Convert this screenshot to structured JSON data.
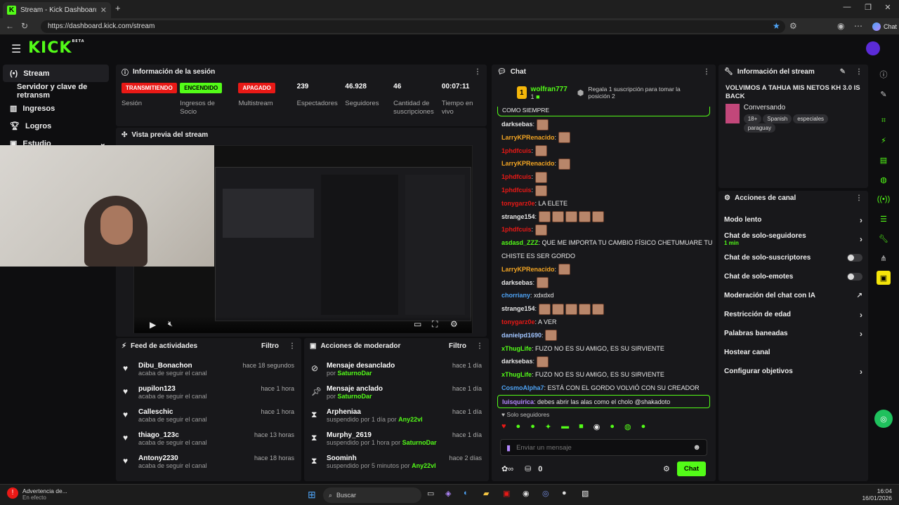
{
  "browser": {
    "tab_title": "Stream - Kick Dashboard",
    "url": "https://dashboard.kick.com/stream",
    "chat_label": "Chat"
  },
  "logo": "KICK",
  "logo_sub": "BETA",
  "sidebar": {
    "items": [
      {
        "label": "Stream",
        "icon": "stream-icon"
      },
      {
        "label": "Servidor y clave de retransm"
      },
      {
        "label": "Ingresos",
        "icon": "chart-icon"
      },
      {
        "label": "Logros",
        "icon": "trophy-icon"
      },
      {
        "label": "Estudio",
        "icon": "studio-icon"
      }
    ]
  },
  "session": {
    "title": "Información de la sesión",
    "badges": [
      {
        "value": "TRANSMITIENDO",
        "label": "Sesión",
        "color": "#e91916",
        "text": "#ffffff"
      },
      {
        "value": "ENCENDIDO",
        "label": "Ingresos de Socio",
        "color": "#53fc18",
        "text": "#000000"
      },
      {
        "value": "APAGADO",
        "label": "Multistream",
        "color": "#e91916",
        "text": "#ffffff"
      }
    ],
    "stats": [
      {
        "value": "239",
        "label": "Espectadores"
      },
      {
        "value": "46.928",
        "label": "Seguidores"
      },
      {
        "value": "46",
        "label": "Cantidad de suscripciones"
      },
      {
        "value": "00:07:11",
        "label": "Tiempo en vivo"
      }
    ]
  },
  "preview": {
    "title": "Vista previa del stream"
  },
  "feed": {
    "title": "Feed de actividades",
    "filter": "Filtro",
    "items": [
      {
        "name": "Dibu_Bonachon",
        "sub": "acaba de seguir el canal",
        "time": "hace 18 segundos"
      },
      {
        "name": "pupilon123",
        "sub": "acaba de seguir el canal",
        "time": "hace 1 hora"
      },
      {
        "name": "Calleschic",
        "sub": "acaba de seguir el canal",
        "time": "hace 1 hora"
      },
      {
        "name": "thiago_123c",
        "sub": "acaba de seguir el canal",
        "time": "hace 13 horas"
      },
      {
        "name": "Antony2230",
        "sub": "acaba de seguir el canal",
        "time": "hace 18 horas"
      }
    ]
  },
  "mod": {
    "title": "Acciones de moderador",
    "filter": "Filtro",
    "items": [
      {
        "name": "Mensaje desanclado",
        "pre": "por ",
        "by": "SaturnoDar",
        "time": "hace 1 día",
        "icon": "unpin-icon"
      },
      {
        "name": "Mensaje anclado",
        "pre": "por ",
        "by": "SaturnoDar",
        "time": "hace 1 día",
        "icon": "pin-icon"
      },
      {
        "name": "Arpheniaa",
        "pre": "suspendido por 1 día por ",
        "by": "Any22vl",
        "time": "hace 1 día",
        "icon": "hourglass-icon"
      },
      {
        "name": "Murphy_2619",
        "pre": "suspendido por 1 hora por ",
        "by": "SaturnoDar",
        "time": "hace 1 día",
        "icon": "hourglass-icon"
      },
      {
        "name": "Soominh",
        "pre": "suspendido por 5 minutos por ",
        "by": "Any22vl",
        "time": "hace 2 días",
        "icon": "hourglass-icon"
      }
    ]
  },
  "chat": {
    "title": "Chat",
    "top_user": "wolfran777",
    "top_count": "1",
    "top_note": "Regala 1 suscripción para tomar la posición 2",
    "pinned_partial": "COMO SIEMPRE",
    "messages": [
      {
        "user": "darksebas",
        "color": "#e8e8e8",
        "text": "",
        "emotes": 1
      },
      {
        "user": "LarryKPRenacido",
        "color": "#f5a623",
        "text": "",
        "emotes": 1
      },
      {
        "user": "1phdfcuis",
        "color": "#e91916",
        "text": "",
        "emotes": 1
      },
      {
        "user": "LarryKPRenacido",
        "color": "#f5a623",
        "text": "",
        "emotes": 1
      },
      {
        "user": "1phdfcuis",
        "color": "#e91916",
        "text": "",
        "emotes": 1
      },
      {
        "user": "1phdfcuis",
        "color": "#e91916",
        "text": "",
        "emotes": 1
      },
      {
        "user": "tonygarz0e",
        "color": "#e91916",
        "text": "LA ELETE",
        "emotes": 0
      },
      {
        "user": "strange154",
        "color": "#e8e8e8",
        "text": "",
        "emotes": 5
      },
      {
        "user": "1phdfcuis",
        "color": "#e91916",
        "text": "",
        "emotes": 1
      },
      {
        "user": "asdasd_ZZZ",
        "color": "#53fc18",
        "text": "QUE ME IMPORTA TU CAMBIO FÍSICO CHETUMUARE TU",
        "emotes": 0
      },
      {
        "user": "",
        "color": "#e8e8e8",
        "text": "CHISTE ES SER GORDO",
        "emotes": 0
      },
      {
        "user": "LarryKPRenacido",
        "color": "#f5a623",
        "text": "",
        "emotes": 1
      },
      {
        "user": "darksebas",
        "color": "#e8e8e8",
        "text": "",
        "emotes": 1
      },
      {
        "user": "chorriany",
        "color": "#4ea3f5",
        "text": "xdxdxd",
        "emotes": 0
      },
      {
        "user": "strange154",
        "color": "#e8e8e8",
        "text": "",
        "emotes": 5
      },
      {
        "user": "tonygarz0e",
        "color": "#e91916",
        "text": "A VER",
        "emotes": 0
      },
      {
        "user": "danielpd1690",
        "color": "#a0c4ff",
        "text": "",
        "emotes": 1
      },
      {
        "user": "xThugLife",
        "color": "#53fc18",
        "text": "FUZO NO ES SU AMIGO, ES SU SIRVIENTE",
        "emotes": 0
      },
      {
        "user": "darksebas",
        "color": "#e8e8e8",
        "text": "",
        "emotes": 1
      },
      {
        "user": "xThugLife",
        "color": "#53fc18",
        "text": "FUZO NO ES SU AMIGO, ES SU SIRVIENTE",
        "emotes": 0
      },
      {
        "user": "CosmoAlpha7",
        "color": "#4ea3f5",
        "text": "ESTÁ CON EL GORDO VOLVIÓ CON SU CREADOR",
        "emotes": 0
      },
      {
        "user": "luisquirica",
        "color": "#b388ff",
        "text": "debes abrir las alas como el cholo @shakadoto",
        "emotes": 0
      }
    ],
    "followers_only": "Solo seguidores",
    "placeholder": "Enviar un mensaje",
    "kicks": "0",
    "send": "Chat"
  },
  "stream_info": {
    "title": "Información del stream",
    "stream_title": "VOLVIMOS A TAHUA MIS NETOS KH 3.0 IS BACK",
    "category": "Conversando",
    "tags": [
      "18+",
      "Spanish",
      "especiales",
      "paraguay"
    ]
  },
  "channel": {
    "title": "Acciones de canal",
    "items": [
      {
        "label": "Modo lento",
        "kind": "chevron",
        "sub": ""
      },
      {
        "label": "Chat de solo-seguidores",
        "kind": "chevron",
        "sub": "1 min"
      },
      {
        "label": "Chat de solo-suscriptores",
        "kind": "toggle",
        "sub": ""
      },
      {
        "label": "Chat de solo-emotes",
        "kind": "toggle",
        "sub": ""
      },
      {
        "label": "Moderación del chat con IA",
        "kind": "external",
        "sub": ""
      },
      {
        "label": "Restricción de edad",
        "kind": "chevron",
        "sub": ""
      },
      {
        "label": "Palabras baneadas",
        "kind": "chevron",
        "sub": ""
      },
      {
        "label": "Hostear canal",
        "kind": "none",
        "sub": ""
      },
      {
        "label": "Configurar objetivos",
        "kind": "chevron",
        "sub": ""
      }
    ]
  },
  "taskbar": {
    "notif_title": "Advertencia de...",
    "notif_sub": "En efecto",
    "search": "Buscar",
    "time": "16:04",
    "date": "16/01/2026"
  },
  "colors": {
    "accent": "#53fc18",
    "live": "#e91916",
    "bg": "#0e0e10",
    "panel": "#18181b"
  }
}
